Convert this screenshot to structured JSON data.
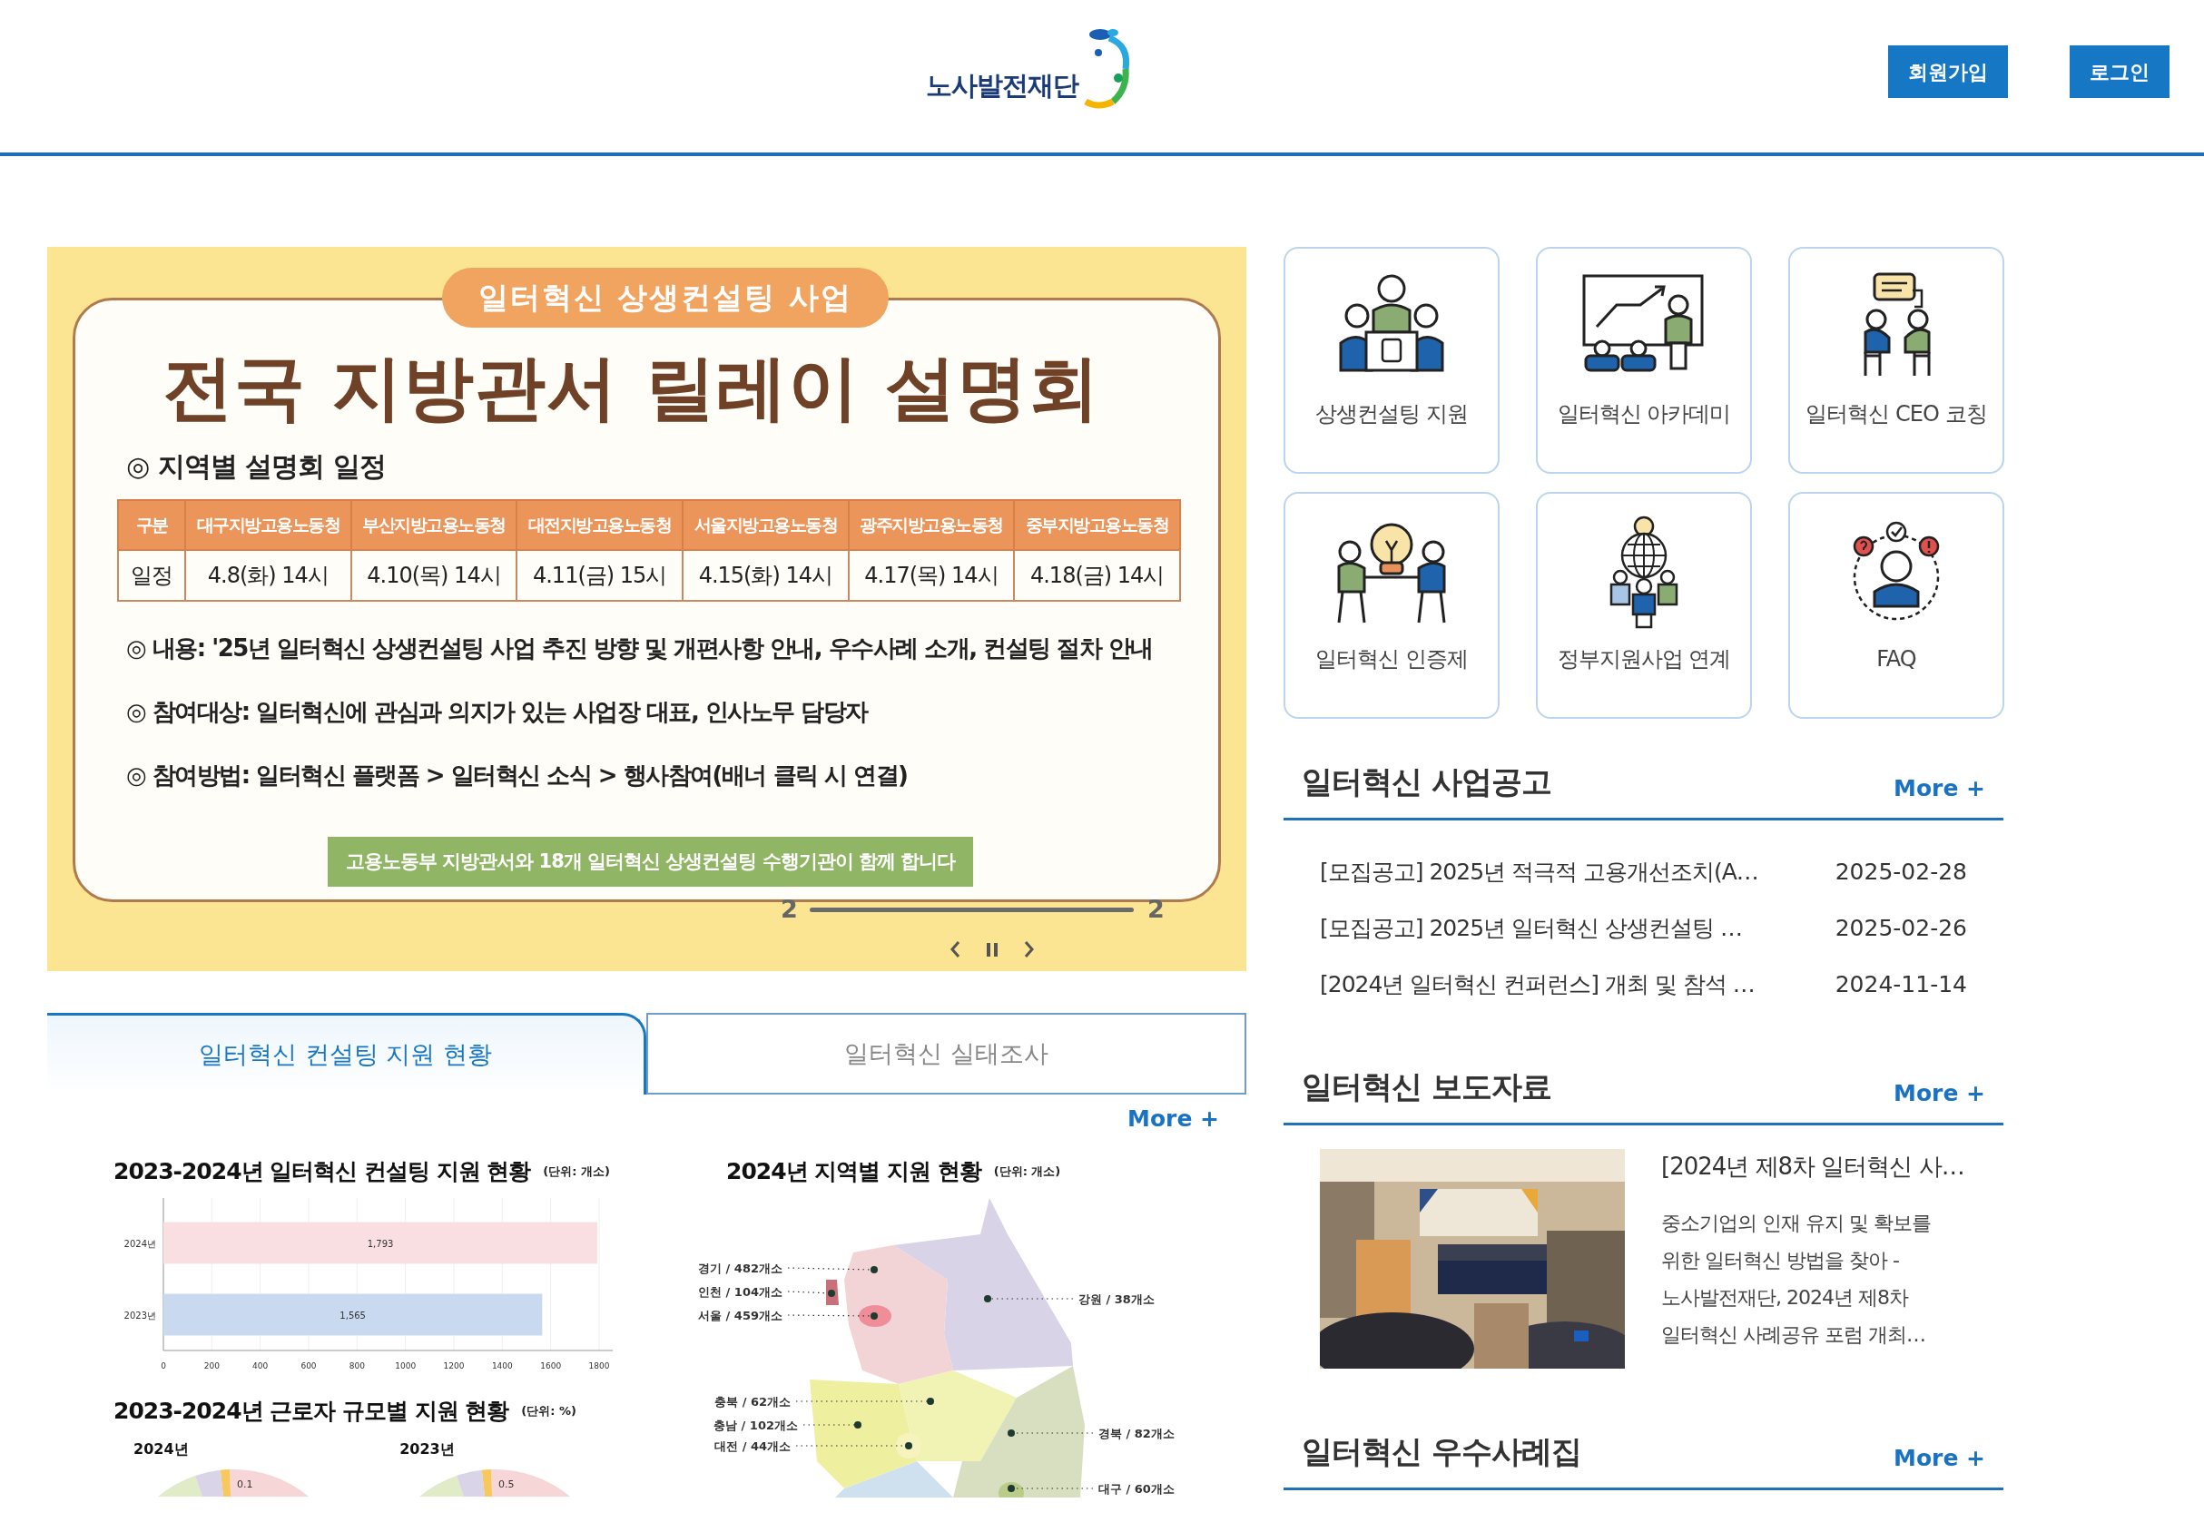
{
  "header": {
    "logo_text": "노사발전재단",
    "buttons": [
      "회원가입",
      "로그인"
    ]
  },
  "banner": {
    "tag": "일터혁신 상생컨설팅 사업",
    "title": "전국 지방관서 릴레이 설명회",
    "schedule_heading": "◎ 지역별 설명회 일정",
    "schedule_table": {
      "columns": [
        "구분",
        "대구지방고용노동청",
        "부산지방고용노동청",
        "대전지방고용노동청",
        "서울지방고용노동청",
        "광주지방고용노동청",
        "중부지방고용노동청"
      ],
      "rows": [
        [
          "일정",
          "4.8(화) 14시",
          "4.10(목) 14시",
          "4.11(금) 15시",
          "4.15(화) 14시",
          "4.17(목) 14시",
          "4.18(금) 14시"
        ]
      ]
    },
    "bullets": [
      "◎ 내용: '25년 일터혁신 상생컨설팅 사업 추진 방향 및 개편사항 안내, 우수사례 소개, 컨설팅 절차 안내",
      "◎ 참여대상: 일터혁신에 관심과 의지가 있는 사업장 대표, 인사노무 담당자",
      "◎ 참여방법: 일터혁신 플랫폼 > 일터혁신 소식 > 행사참여(배너 클릭 시 연결)"
    ],
    "caption": "고용노동부 지방관서와 18개 일터혁신 상생컨설팅 수행기관이 함께 합니다",
    "slide": {
      "current": "2",
      "total": "2",
      "level": 1
    }
  },
  "quick_links": [
    {
      "label": "상생컨설팅 지원",
      "kind": "meeting"
    },
    {
      "label": "일터혁신 아카데미",
      "kind": "presentation"
    },
    {
      "label": "일터혁신 CEO 코칭",
      "kind": "coaching"
    },
    {
      "label": "일터혁신 인증제",
      "kind": "idea"
    },
    {
      "label": "정부지원사업 연계",
      "kind": "network"
    },
    {
      "label": "FAQ",
      "kind": "faq"
    }
  ],
  "tabs": [
    {
      "label": "일터혁신 컨설팅 지원 현황",
      "selected": true
    },
    {
      "label": "일터혁신 실태조사",
      "selected": false
    }
  ],
  "tab_more": "More +",
  "consulting_chart": {
    "title": "2023-2024년 일터혁신 컨설팅 지원 현황",
    "unit": "(단위: 개소)",
    "chart_data": {
      "type": "bar",
      "orientation": "horizontal",
      "categories": [
        "2024년",
        "2023년"
      ],
      "values": [
        1793,
        1565
      ],
      "colors": [
        "#f9dfe1",
        "#c8d9f0"
      ],
      "value_labels": [
        "1,793",
        "1,565"
      ],
      "xlim": [
        0,
        1800
      ],
      "xticks": [
        0,
        200,
        400,
        600,
        800,
        1000,
        1200,
        1400,
        1600,
        1800
      ],
      "grid": true
    }
  },
  "size_chart": {
    "title": "2023-2024년 근로자 규모별 지원 현황",
    "unit": "(단위: %)",
    "pies": [
      {
        "label": "2024년",
        "value_label": "0.1"
      },
      {
        "label": "2023년",
        "value_label": "0.5"
      }
    ]
  },
  "region_map": {
    "title": "2024년 지역별 지원 현황",
    "unit": "(단위: 개소)",
    "regions": [
      {
        "label": "경기 / 482개소"
      },
      {
        "label": "인천 / 104개소"
      },
      {
        "label": "서울 / 459개소"
      },
      {
        "label": "강원 / 38개소"
      },
      {
        "label": "충북 / 62개소"
      },
      {
        "label": "충남 / 102개소"
      },
      {
        "label": "대전 / 44개소"
      },
      {
        "label": "경북 / 82개소"
      },
      {
        "label": "대구 / 60개소"
      }
    ]
  },
  "notices": {
    "title": "일터혁신 사업공고",
    "more": "More +",
    "items": [
      {
        "title": "[모집공고] 2025년 적극적 고용개선조치(A…",
        "date": "2025-02-28"
      },
      {
        "title": "[모집공고] 2025년 일터혁신 상생컨설팅 …",
        "date": "2025-02-26"
      },
      {
        "title": "[2024년 일터혁신 컨퍼런스] 개최 및 참석 …",
        "date": "2024-11-14"
      }
    ]
  },
  "press": {
    "title": "일터혁신 보도자료",
    "more": "More +",
    "article": {
      "title": "[2024년 제8차 일터혁신 사…",
      "summary": "중소기업의 인재 유지 및 확보를 위한 일터혁신 방법을 찾아 - 노사발전재단, 2024년 제8차 일터혁신 사례공유 포럼 개최…"
    }
  },
  "cases": {
    "title": "일터혁신 우수사례집",
    "more": "More +"
  }
}
